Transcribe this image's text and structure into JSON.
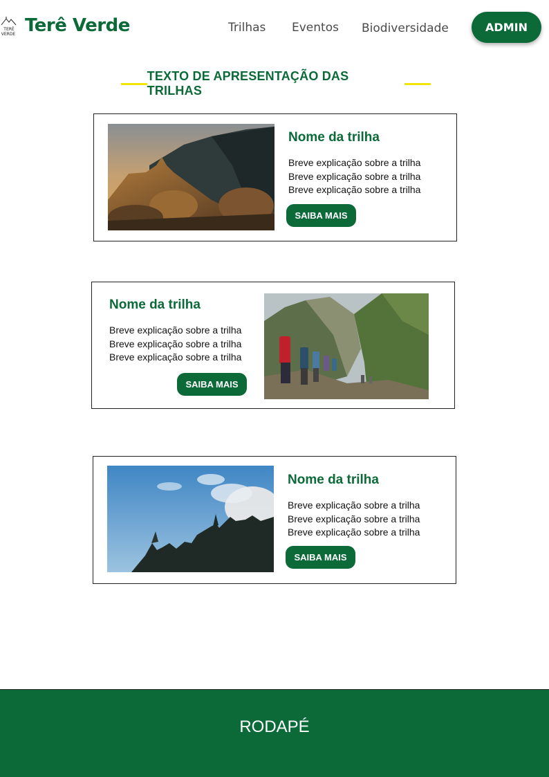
{
  "header": {
    "brand": "Terê Verde",
    "logo_text_top": "TERÊ",
    "logo_text_bottom": "VERDE",
    "nav": [
      {
        "label": "Trilhas"
      },
      {
        "label": "Eventos"
      },
      {
        "label": "Biodiversidade"
      }
    ],
    "admin_label": "ADMIN"
  },
  "main": {
    "section_title": "TEXTO DE APRESENTAÇÃO DAS TRILHAS",
    "cards": [
      {
        "title": "Nome da trilha",
        "description_lines": [
          "Breve explicação sobre a trilha",
          "Breve explicação sobre a trilha",
          "Breve explicação sobre a trilha"
        ],
        "button_label": "SAIBA MAIS",
        "image": "rocky-summit-sunset-photo"
      },
      {
        "title": "Nome da trilha",
        "description_lines": [
          "Breve explicação sobre a trilha",
          "Breve explicação sobre a trilha",
          "Breve explicação sobre a trilha"
        ],
        "button_label": "SAIBA MAIS",
        "image": "hikers-on-mountain-trail-photo"
      },
      {
        "title": "Nome da trilha",
        "description_lines": [
          "Breve explicação sobre a trilha",
          "Breve explicação sobre a trilha",
          "Breve explicação sobre a trilha"
        ],
        "button_label": "SAIBA MAIS",
        "image": "mountain-peaks-blue-sky-photo"
      }
    ]
  },
  "footer": {
    "label": "RODAPÉ"
  },
  "colors": {
    "brand_green": "#0c6a39",
    "accent_yellow": "#f2e600"
  }
}
